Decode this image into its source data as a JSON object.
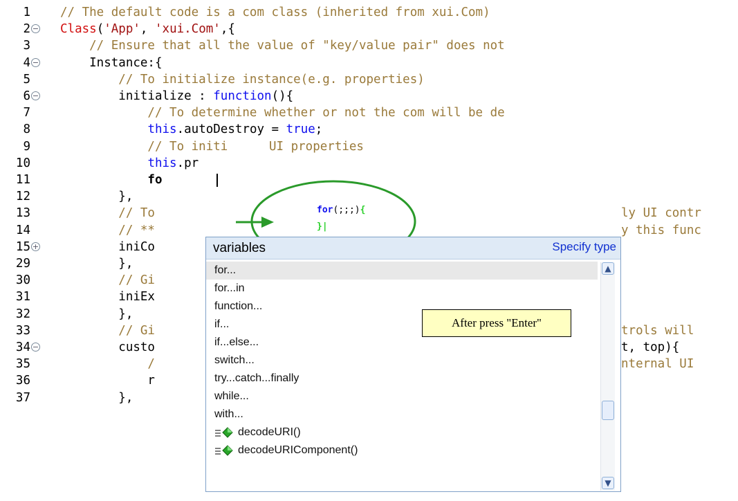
{
  "editor": {
    "lines": [
      {
        "n": "1",
        "fold": "",
        "parts": [
          {
            "t": "// The default code is a com class (inherited from xui.Com)",
            "c": "cm"
          }
        ]
      },
      {
        "n": "2",
        "fold": "minus",
        "parts": [
          {
            "t": "Class",
            "c": "cls"
          },
          {
            "t": "(",
            "c": ""
          },
          {
            "t": "'App'",
            "c": "str"
          },
          {
            "t": ", ",
            "c": ""
          },
          {
            "t": "'xui.Com'",
            "c": "str"
          },
          {
            "t": ",{",
            "c": ""
          }
        ]
      },
      {
        "n": "3",
        "fold": "",
        "parts": [
          {
            "t": "    // Ensure that all the value of \"key/value pair\" does not",
            "c": "cm"
          }
        ]
      },
      {
        "n": "4",
        "fold": "minus",
        "parts": [
          {
            "t": "    Instance:{",
            "c": ""
          }
        ]
      },
      {
        "n": "5",
        "fold": "",
        "parts": [
          {
            "t": "        // To initialize instance(e.g. properties)",
            "c": "cm"
          }
        ]
      },
      {
        "n": "6",
        "fold": "minus",
        "parts": [
          {
            "t": "        initialize : ",
            "c": ""
          },
          {
            "t": "function",
            "c": "kw"
          },
          {
            "t": "(){",
            "c": ""
          }
        ]
      },
      {
        "n": "7",
        "fold": "",
        "parts": [
          {
            "t": "            // To determine whether or not the com will be de",
            "c": "cm"
          }
        ]
      },
      {
        "n": "8",
        "fold": "",
        "parts": [
          {
            "t": "            ",
            "c": ""
          },
          {
            "t": "this",
            "c": "kw"
          },
          {
            "t": ".autoDestroy = ",
            "c": ""
          },
          {
            "t": "true",
            "c": "kw"
          },
          {
            "t": ";",
            "c": ""
          }
        ]
      },
      {
        "n": "9",
        "fold": "",
        "parts": [
          {
            "t": "            // To initi",
            "c": "cm"
          }
        ]
      },
      {
        "n": "10",
        "fold": "",
        "parts": [
          {
            "t": "            ",
            "c": ""
          },
          {
            "t": "this",
            "c": "kw"
          },
          {
            "t": ".pr",
            "c": ""
          }
        ]
      },
      {
        "n": "11",
        "fold": "",
        "parts": [
          {
            "t": "            fo",
            "c": "bold"
          }
        ]
      },
      {
        "n": "12",
        "fold": "",
        "parts": [
          {
            "t": "        },",
            "c": ""
          }
        ]
      },
      {
        "n": "13",
        "fold": "",
        "parts": [
          {
            "t": "        // To",
            "c": "cm"
          }
        ]
      },
      {
        "n": "14",
        "fold": "",
        "parts": [
          {
            "t": "        // **",
            "c": "cm"
          }
        ]
      },
      {
        "n": "15",
        "fold": "plus",
        "parts": [
          {
            "t": "        iniCo",
            "c": ""
          }
        ]
      },
      {
        "n": "29",
        "fold": "",
        "parts": [
          {
            "t": "        },",
            "c": ""
          }
        ]
      },
      {
        "n": "30",
        "fold": "",
        "parts": [
          {
            "t": "        // Gi",
            "c": "cm"
          }
        ]
      },
      {
        "n": "31",
        "fold": "",
        "parts": [
          {
            "t": "        iniEx",
            "c": ""
          }
        ]
      },
      {
        "n": "32",
        "fold": "",
        "parts": [
          {
            "t": "        },",
            "c": ""
          }
        ]
      },
      {
        "n": "33",
        "fold": "",
        "parts": [
          {
            "t": "        // Gi",
            "c": "cm"
          }
        ]
      },
      {
        "n": "34",
        "fold": "minus",
        "parts": [
          {
            "t": "        custo",
            "c": ""
          }
        ]
      },
      {
        "n": "35",
        "fold": "",
        "parts": [
          {
            "t": "            /",
            "c": "cm"
          }
        ]
      },
      {
        "n": "36",
        "fold": "",
        "parts": [
          {
            "t": "            r",
            "c": ""
          }
        ]
      },
      {
        "n": "37",
        "fold": "",
        "parts": [
          {
            "t": "        },",
            "c": ""
          }
        ]
      }
    ],
    "right_fragments": {
      "l9": "UI properties",
      "l13": "ly UI contr",
      "l14": "y this func",
      "l33": "trols will",
      "l34": "t, top){",
      "l35": "nternal UI"
    }
  },
  "popup": {
    "title": "variables",
    "link": "Specify type",
    "items": [
      {
        "label": "for...",
        "icon": "",
        "selected": true
      },
      {
        "label": "for...in",
        "icon": ""
      },
      {
        "label": "function...",
        "icon": ""
      },
      {
        "label": "if...",
        "icon": ""
      },
      {
        "label": "if...else...",
        "icon": ""
      },
      {
        "label": "switch...",
        "icon": ""
      },
      {
        "label": "try...catch...finally",
        "icon": ""
      },
      {
        "label": "while...",
        "icon": ""
      },
      {
        "label": "with...",
        "icon": ""
      },
      {
        "label": "decodeURI()",
        "icon": "method-icon"
      },
      {
        "label": "decodeURIComponent()",
        "icon": "method-icon"
      }
    ]
  },
  "preview_bubble": {
    "line1_kw": "for",
    "line1_rest": "(;;;)",
    "line1_brace": "{",
    "line2": "}|"
  },
  "callout": {
    "text": "After press \"Enter\""
  },
  "colors": {
    "comment": "#9a7a3a",
    "keyword": "#1010ee",
    "class": "#d21010",
    "string": "#a01010",
    "popup_header": "#dfeaf6",
    "callout_fill": "#ffffc2",
    "bubble_fill": "#ffffff",
    "bubble_stroke": "#2a9a2a"
  }
}
